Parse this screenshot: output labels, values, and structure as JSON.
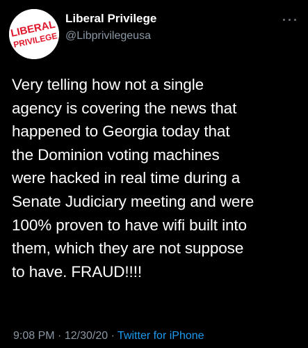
{
  "account": {
    "display_name": "Liberal Privilege",
    "handle": "@Libprivilegeusa",
    "avatar_text": [
      "LIBERAL",
      "PRIVILEGE"
    ],
    "avatar_color": "#e0162b"
  },
  "tweet": {
    "text": "Very telling how not a single\nagency is covering the news that\nhappened to Georgia today that\nthe Dominion voting machines\nwere hacked in real time during a\nSenate Judiciary meeting and were\n100% proven to have wifi built into\nthem, which they are not suppose\nto have. FRAUD!!!!",
    "time": "9:08 PM",
    "date": "12/30/20",
    "separator": "·",
    "source": "Twitter for iPhone"
  },
  "icons": {
    "more": "more-options-icon"
  },
  "colors": {
    "background": "#000000",
    "text": "#ffffff",
    "secondary": "#8b98a5",
    "link": "#1d9bf0"
  }
}
